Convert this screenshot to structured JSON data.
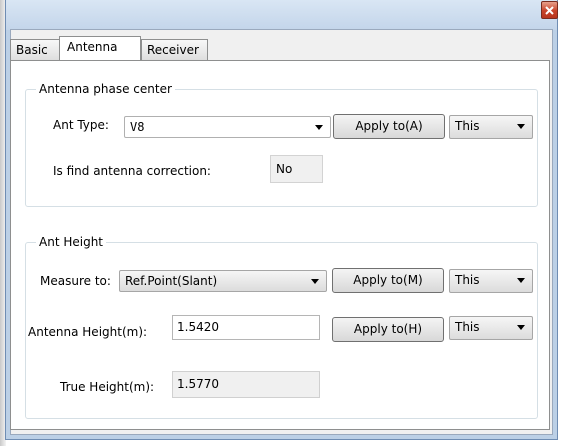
{
  "tabs": [
    "Basic",
    "Antenna",
    "Receiver"
  ],
  "antenna_phase_center": {
    "legend": "Antenna phase center",
    "ant_type_label": "Ant Type:",
    "ant_type_value": "V8",
    "apply_label": "Apply to(A)",
    "scope_value": "This",
    "correction_label": "Is find antenna correction:",
    "correction_value": "No"
  },
  "ant_height": {
    "legend": "Ant Height",
    "measure_label": "Measure to:",
    "measure_value": "Ref.Point(Slant)",
    "measure_apply_label": "Apply to(M)",
    "measure_scope_value": "This",
    "height_label": "Antenna Height(m):",
    "height_value": "1.5420",
    "height_apply_label": "Apply to(H)",
    "height_scope_value": "This",
    "true_height_label": "True Height(m):",
    "true_height_value": "1.5770"
  },
  "colors": {
    "close_button": "#c7432a",
    "window_frame": "#bcd0e6"
  }
}
